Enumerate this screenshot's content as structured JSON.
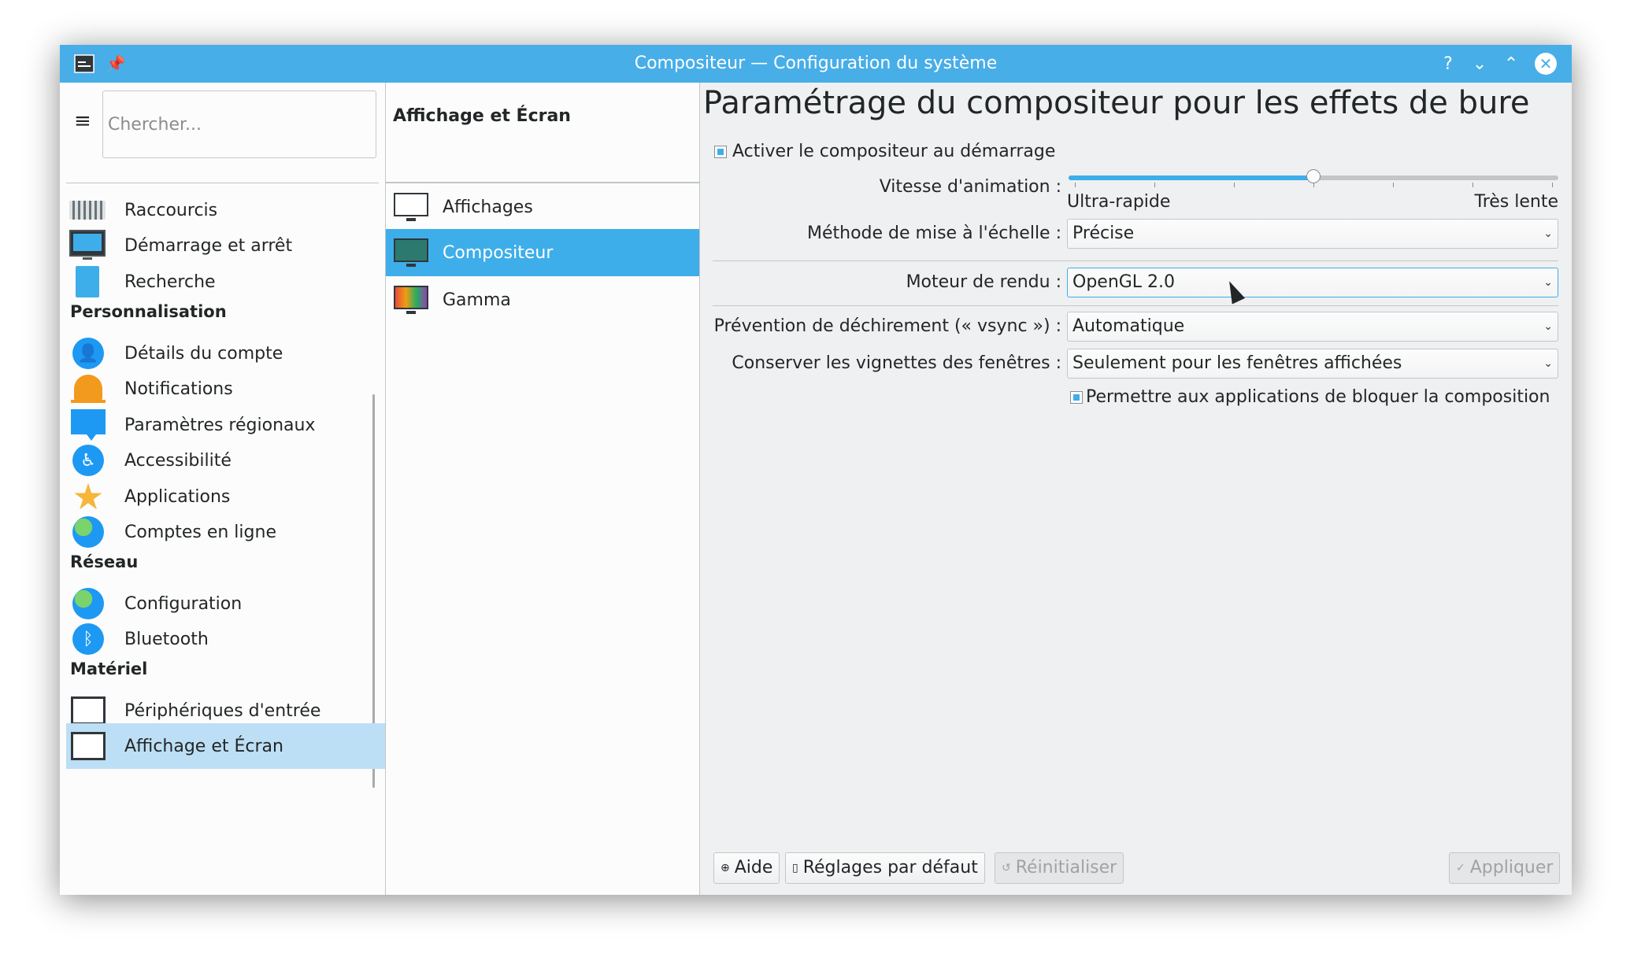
{
  "window": {
    "title": "Compositeur — Configuration du système"
  },
  "sidebar": {
    "search_placeholder": "Chercher...",
    "items_top": [
      {
        "label": "Raccourcis",
        "icon": "keyboard-icon"
      },
      {
        "label": "Démarrage et arrêt",
        "icon": "monitor-icon"
      },
      {
        "label": "Recherche",
        "icon": "search-doc-icon"
      }
    ],
    "section_personnalisation": "Personnalisation",
    "items_personnalisation": [
      {
        "label": "Détails du compte",
        "icon": "user-icon"
      },
      {
        "label": "Notifications",
        "icon": "bell-icon"
      },
      {
        "label": "Paramètres régionaux",
        "icon": "speech-bubble-icon"
      },
      {
        "label": "Accessibilité",
        "icon": "wheelchair-icon"
      },
      {
        "label": "Applications",
        "icon": "star-icon"
      },
      {
        "label": "Comptes en ligne",
        "icon": "globe-icon"
      }
    ],
    "section_reseau": "Réseau",
    "items_reseau": [
      {
        "label": "Configuration",
        "icon": "globe-icon"
      },
      {
        "label": "Bluetooth",
        "icon": "bluetooth-icon"
      }
    ],
    "section_materiel": "Matériel",
    "items_materiel": [
      {
        "label": "Périphériques d'entrée",
        "icon": "input-devices-icon"
      },
      {
        "label": "Affichage et Écran",
        "icon": "display-icon"
      }
    ]
  },
  "middle": {
    "title": "Affichage et Écran",
    "items": [
      {
        "label": "Affichages"
      },
      {
        "label": "Compositeur"
      },
      {
        "label": "Gamma"
      }
    ]
  },
  "compositor": {
    "page_title": "Paramétrage du compositeur pour les effets de bure",
    "enable_on_startup": "Activer le compositeur au démarrage",
    "animation_speed_label": "Vitesse d'animation :",
    "animation_speed_min": "Ultra-rapide",
    "animation_speed_max": "Très lente",
    "animation_speed_value": 0.5,
    "scaling_label": "Méthode de mise à l'échelle :",
    "scaling_value": "Précise",
    "backend_label": "Moteur de rendu :",
    "backend_value": "OpenGL 2.0",
    "vsync_label": "Prévention de déchirement (« vsync ») :",
    "vsync_value": "Automatique",
    "thumbnails_label": "Conserver les vignettes des fenêtres :",
    "thumbnails_value": "Seulement pour les fenêtres affichées",
    "allow_block": "Permettre aux applications de bloquer la composition"
  },
  "buttons": {
    "help": "Aide",
    "defaults": "Réglages par défaut",
    "reset": "Réinitialiser",
    "apply": "Appliquer"
  },
  "colors": {
    "accent": "#3daee9",
    "titlebar": "#47aee8",
    "selection_light": "#bcdff5"
  }
}
